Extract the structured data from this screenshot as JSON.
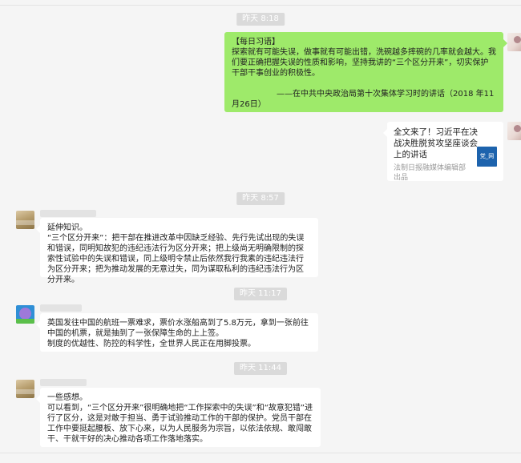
{
  "timestamps": [
    "昨天 8:18",
    "昨天 8:57",
    "昨天 11:17",
    "昨天 11:44"
  ],
  "messages": {
    "daily_quote": {
      "heading": "【每日习语】",
      "body": "探索就有可能失误，做事就有可能出错，洗碗越多摔碗的几率就会越大。我们要正确把握失误的性质和影响，坚持我讲的“三个区分开来”，切实保护干部干事创业的积极性。",
      "signature": "——在中共中央政治局第十次集体学习时的讲话（2018 年11月26日）"
    },
    "link_card": {
      "title": "全文来了！习近平在决战决胜脱贫攻坚座谈会上的讲话",
      "source": "法制日报融媒体编辑部出品",
      "thumb_label": "党_网"
    },
    "extend_knowledge": {
      "lead": "延伸知识。",
      "body": "“三个区分开来”：把干部在推进改革中因缺乏经验、先行先试出现的失误和错误，同明知故犯的违纪违法行为区分开来；把上级尚无明确限制的探索性试验中的失误和错误，同上级明令禁止后依然我行我素的违纪违法行为区分开来；把为推动发展的无意过失，同为谋取私利的违纪违法行为区分开来。"
    },
    "flight_story": {
      "line1": "英国发往中国的航班一票难求，票价水涨船高到了5.8万元，拿到一张前往中国的机票，就是抽到了一张保障生命的上上签。",
      "line2": "制度的优越性、防控的科学性，全世界人民正在用脚投票。"
    },
    "reflection": {
      "lead": "一些感想。",
      "body": "可以看到，“三个区分开来”很明确地把“工作探索中的失误”和“故意犯错”进行了区分，这是对敢于担当、勇于试验推动工作的干部的保护。党员干部在工作中要挺起腰板、放下心来，以为人民服务为宗旨，以依法依规、敢闯敢干、干就干好的决心推动各项工作落地落实。"
    }
  }
}
